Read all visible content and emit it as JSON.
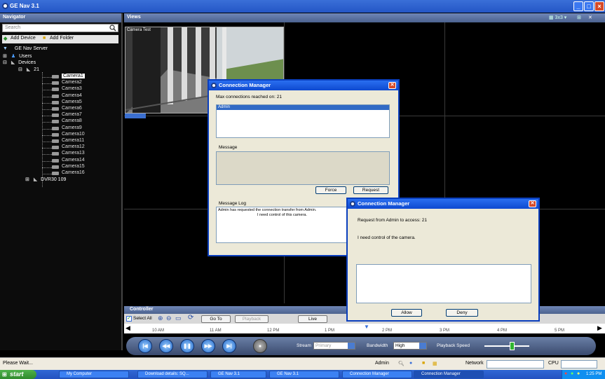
{
  "window": {
    "title": "GE Nav 3.1"
  },
  "navigator": {
    "header": "Navigator",
    "search_placeholder": "Search",
    "add_device": "Add Device",
    "add_folder": "Add Folder",
    "server": "GE Nav Server",
    "users": "Users",
    "devices": "Devices",
    "device_21": "21",
    "cameras": [
      "Camera1",
      "Camera2",
      "Camera3",
      "Camera4",
      "Camera5",
      "Camera6",
      "Camera7",
      "Camera8",
      "Camera9",
      "Camera10",
      "Camera11",
      "Camera12",
      "Camera13",
      "Camera14",
      "Camera15",
      "Camera16"
    ],
    "selected_camera": "Camera1",
    "device_2": "DVR30 109"
  },
  "views": {
    "header": "Views",
    "camera_label": "Camera Test"
  },
  "controller": {
    "header": "Controller",
    "select_all": "Select All",
    "goto": "Go To",
    "playback": "Playback",
    "live": "Live",
    "timeline_ticks": [
      "10 AM",
      "11 AM",
      "12 PM",
      "1 PM",
      "2 PM",
      "3 PM",
      "4 PM",
      "5 PM"
    ],
    "stream_label": "Stream",
    "stream_value": "Primary",
    "bandwidth_label": "Bandwidth",
    "bandwidth_value": "High",
    "playback_speed_label": "Playback Speed"
  },
  "status": {
    "left": "Please Wait...",
    "user": "Admin",
    "network_label": "Network",
    "cpu_label": "CPU"
  },
  "taskbar": {
    "start": "start",
    "tasks": [
      "My Computer",
      "Download details: SQ...",
      "GE Nav 3.1",
      "GE Nav 3.1",
      "Connection Manager",
      "Connection Manager"
    ],
    "clock": "1:25 PM"
  },
  "dialog1": {
    "title": "Connection Manager",
    "max_text": "Max connections reached on: 21",
    "list_item": "Admin",
    "message_label": "Message",
    "force": "Force",
    "request": "Request",
    "log_label": "Message Log",
    "log_line1": "Admin has requested the connection transfer from Admin.",
    "log_line2": "I need control of this camera."
  },
  "dialog2": {
    "title": "Connection Manager",
    "request_text": "Request from Admin to access: 21",
    "message": "I need control of the camera.",
    "allow": "Allow",
    "deny": "Deny"
  },
  "colors": {
    "titlebar": "#2456c5",
    "panel_header": "#5a6f9e",
    "dialog_border": "#0a3ebd"
  }
}
